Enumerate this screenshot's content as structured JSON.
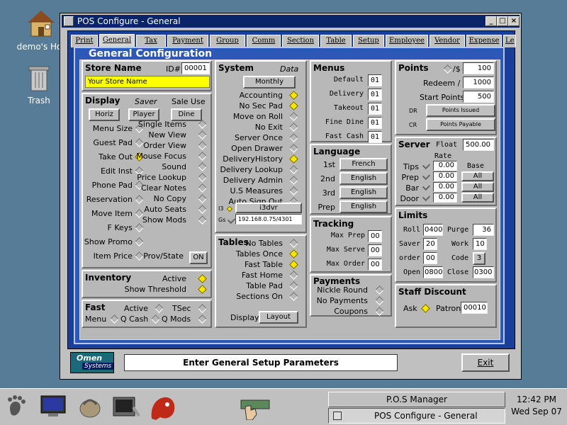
{
  "desktop": {
    "icons": [
      {
        "label": "demo's Hor",
        "icon": "home-icon"
      },
      {
        "label": "Trash",
        "icon": "trash-icon"
      }
    ]
  },
  "window": {
    "title": "POS Configure - General"
  },
  "tabs": [
    "Print",
    "General",
    "Tax",
    "Payment",
    "Group",
    "Comm",
    "Section",
    "Table",
    "Setup",
    "Employee",
    "Vendor",
    "Expense",
    "Le"
  ],
  "heading": "General Configuration",
  "store": {
    "title": "Store Name",
    "id_label": "ID#",
    "id_value": "00001",
    "name_value": "Your Store Name"
  },
  "display": {
    "title": "Display",
    "saver_label": "Saver",
    "sale_use_label": "Sale Use",
    "buttons": [
      "Horiz",
      "Player",
      "Dine"
    ],
    "left_items": [
      "Menu Size",
      "Guest Pad",
      "Take Out",
      "Edit Inst",
      "Phone Pad",
      "Reservation",
      "Move Item",
      "F Keys",
      "Show Promo",
      "Item Price"
    ],
    "right_items": [
      "Single Items",
      "New View",
      "Order View",
      "Mouse Focus",
      "Sound",
      "Price Lookup",
      "Clear Notes",
      "No Copy",
      "Auto Seats",
      "Show Mods",
      "Prov/State"
    ],
    "prov_state_button": "ON"
  },
  "inventory": {
    "title": "Inventory",
    "items": [
      "Active",
      "Show Threshold"
    ]
  },
  "fast": {
    "title": "Fast",
    "active_label": "Active",
    "tsec_label": "TSec",
    "menu_label": "Menu",
    "qcash_label": "Q Cash",
    "qmods_label": "Q Mods"
  },
  "system": {
    "title": "System",
    "data_label": "Data",
    "period_button": "Monthly",
    "items": [
      "Accounting",
      "No Sec Pad",
      "Move on Roll",
      "No Exit",
      "Server Once",
      "Open Drawer",
      "DeliveryHistory",
      "Delivery Lookup",
      "Delivery Admin",
      "U.S Measures",
      "Auto Sign Out"
    ],
    "i3_label": "I3",
    "i3_value": "i3dvr",
    "gs_label": "Gs",
    "gs_value": "192.168.0.75/4301"
  },
  "tables": {
    "title": "Tables",
    "items": [
      "No Tables",
      "Tables Once",
      "Fast Table",
      "Fast Home",
      "Table Pad",
      "Sections On"
    ],
    "display_label": "Display",
    "layout_button": "Layout"
  },
  "menus": {
    "title": "Menus",
    "items": [
      {
        "label": "Default",
        "value": "01"
      },
      {
        "label": "Delivery",
        "value": "01"
      },
      {
        "label": "Takeout",
        "value": "01"
      },
      {
        "label": "Fine Dine",
        "value": "01"
      },
      {
        "label": "Fast Cash",
        "value": "01"
      }
    ]
  },
  "language": {
    "title": "Language",
    "items": [
      {
        "label": "1st",
        "value": "French"
      },
      {
        "label": "2nd",
        "value": "English"
      },
      {
        "label": "3rd",
        "value": "English"
      },
      {
        "label": "Prep",
        "value": "English"
      }
    ]
  },
  "tracking": {
    "title": "Tracking",
    "items": [
      {
        "label": "Max Prep",
        "value": "00"
      },
      {
        "label": "Max Serve",
        "value": "00"
      },
      {
        "label": "Max Order",
        "value": "00"
      }
    ]
  },
  "payments": {
    "title": "Payments",
    "items": [
      "Nickle Round",
      "No Payments",
      "Coupons"
    ]
  },
  "points": {
    "title": "Points",
    "per_dollar_label": "/$",
    "per_dollar_value": "100",
    "redeem_label": "Redeem / $",
    "redeem_value": "1000",
    "start_label": "Start Points",
    "start_value": "500",
    "dr_label": "DR",
    "dr_button": "Points Issued",
    "cr_label": "CR",
    "cr_button": "Points Payable"
  },
  "server": {
    "title": "Server",
    "float_label": "Float",
    "float_value": "500.00",
    "rate_label": "Rate",
    "base_label": "Base",
    "rows": [
      {
        "label": "Tips",
        "value": "0.00",
        "base": ""
      },
      {
        "label": "Prep",
        "value": "0.00",
        "base": "All"
      },
      {
        "label": "Bar",
        "value": "0.00",
        "base": "All"
      },
      {
        "label": "Door",
        "value": "0.00",
        "base": "All"
      }
    ]
  },
  "limits": {
    "title": "Limits",
    "roll_label": "Roll",
    "roll_value": "0400",
    "purge_label": "Purge",
    "purge_value": "36",
    "saver_label": "Saver",
    "saver_value": "20",
    "work_label": "Work",
    "work_value": "10",
    "order_label": "order",
    "order_value": "00",
    "code_label": "Code",
    "code_value": "3",
    "open_label": "Open",
    "open_value": "0800",
    "close_label": "Close",
    "close_value": "0300"
  },
  "staff": {
    "title": "Staff Discount",
    "ask_label": "Ask",
    "patron_label": "Patron",
    "patron_value": "00010"
  },
  "logo": {
    "line1": "Omen",
    "line2": "Systems"
  },
  "status": {
    "message": "Enter General Setup Parameters",
    "exit_button": "Exit"
  },
  "taskbar": {
    "tasks": [
      "P.O.S Manager",
      "POS Configure - General"
    ],
    "time": "12:42 PM",
    "date": "Wed Sep 07"
  },
  "colors": {
    "desktop": "#577c97",
    "title": "#0a246a",
    "frame": "#1a3f9a",
    "panel": "#2d58b8",
    "active_diamond": "#ffe400",
    "store_field": "#ffff00"
  }
}
